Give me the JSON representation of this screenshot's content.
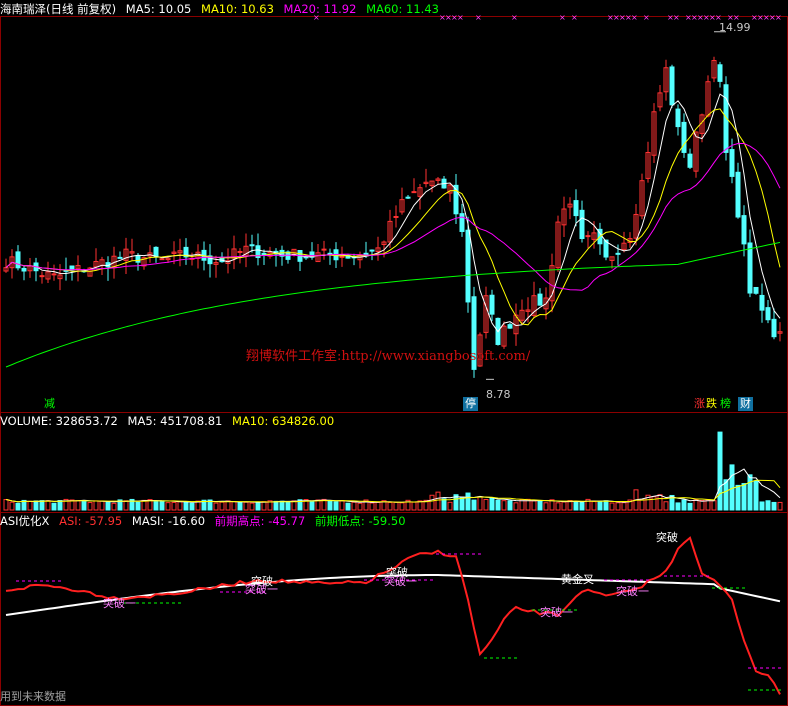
{
  "main_header": {
    "stock_name": "海南瑞泽(日线 前复权)",
    "ma5": "MA5: 10.05",
    "ma10": "MA10: 10.63",
    "ma20": "MA20: 11.92",
    "ma60": "MA60: 11.43"
  },
  "volume_header": {
    "volume": "VOLUME: 328653.72",
    "ma5": "MA5: 451708.81",
    "ma10": "MA10: 634826.00"
  },
  "asi_header": {
    "title": "ASI优化X",
    "asi": "ASI: -57.95",
    "masi": "MASI: -16.60",
    "prev_high": "前期高点: -45.77",
    "prev_low": "前期低点: -59.50"
  },
  "watermark": "翔博软件工作室:http://www.xiangbosoft.com/",
  "footer": "用到未来数据",
  "markers": {
    "high_label": "14.99",
    "low_label": "8.78",
    "tag_jian": "减",
    "tag_ting": "停",
    "tag_zhang": "涨",
    "tag_die": "跌",
    "tag_bang": "榜",
    "tag_cai": "财"
  },
  "asi_labels": {
    "tupo": "突破",
    "tupo_yi": "突破一",
    "huangjinchao": "黄金叉"
  },
  "colors": {
    "background": "#000000",
    "panel_border": "#8b0000",
    "up": "#ff3232",
    "down": "#54ffff",
    "ma5": "#ffffff",
    "ma10": "#ffff00",
    "ma20": "#ff00ff",
    "ma60": "#00ff00",
    "asi": "#ff2020",
    "masi": "#ffffff"
  },
  "chart_data": [
    {
      "type": "candlestick",
      "title": "海南瑞泽(日线 前复权)",
      "ylim": [
        8.5,
        15.2
      ],
      "annotations": {
        "highest": 14.99,
        "lowest": 8.78
      },
      "series": [
        {
          "name": "MA5",
          "last": 10.05
        },
        {
          "name": "MA10",
          "last": 10.63
        },
        {
          "name": "MA20",
          "last": 11.92
        },
        {
          "name": "MA60",
          "last": 11.43
        }
      ]
    },
    {
      "type": "bar",
      "title": "VOLUME",
      "series": [
        {
          "name": "VOLUME",
          "last": 328653.72
        },
        {
          "name": "MA5",
          "last": 451708.81
        },
        {
          "name": "MA10",
          "last": 634826.0
        }
      ]
    },
    {
      "type": "line",
      "title": "ASI优化X",
      "series": [
        {
          "name": "ASI",
          "last": -57.95
        },
        {
          "name": "MASI",
          "last": -16.6
        }
      ],
      "prev_high": -45.77,
      "prev_low": -59.5
    }
  ]
}
